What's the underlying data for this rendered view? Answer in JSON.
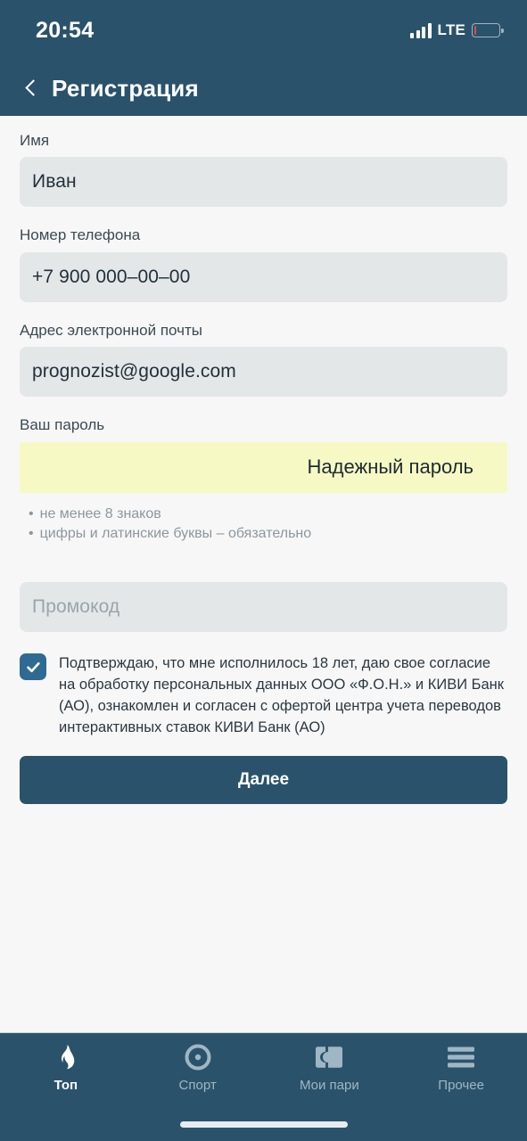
{
  "status_bar": {
    "time": "20:54",
    "network_label": "LTE",
    "signal_icon": "signal-bars-icon",
    "battery_icon": "battery-low-icon",
    "battery_level_percent": 10
  },
  "header": {
    "back_icon": "chevron-left-icon",
    "title": "Регистрация"
  },
  "form": {
    "fields": [
      {
        "label": "Имя",
        "value": "Иван",
        "placeholder": "",
        "name": "first-name"
      },
      {
        "label": "Номер телефона",
        "value": "+7 900 000–00–00",
        "placeholder": "",
        "name": "phone-number"
      },
      {
        "label": "Адрес электронной почты",
        "value": "prognozist@google.com",
        "placeholder": "",
        "name": "email"
      }
    ],
    "password": {
      "label": "Ваш пароль",
      "value": "",
      "strength_text": "Надежный пароль",
      "strength_bg_color": "#F7F9C4",
      "hints": [
        "не менее 8 знаков",
        "цифры и латинские буквы – обязательно"
      ]
    },
    "promo": {
      "label": "",
      "placeholder": "Промокод",
      "value": ""
    },
    "consent": {
      "checked": true,
      "checkbox_color": "#2E6A92",
      "check_icon": "checkmark-icon",
      "text": "Подтверждаю, что мне исполнилось 18 лет, даю свое согласие на обработку персональных данных ООО «Ф.О.Н.» и КИВИ Банк (АО), ознакомлен и согласен с офертой центра учета переводов интерактивных ставок КИВИ Банк (АО)"
    },
    "submit_label": "Далее"
  },
  "bottom_nav": {
    "items": [
      {
        "label": "Топ",
        "icon": "flame-icon",
        "active": true
      },
      {
        "label": "Спорт",
        "icon": "target-circle-icon",
        "active": false
      },
      {
        "label": "Мои пари",
        "icon": "ticket-icon",
        "active": false
      },
      {
        "label": "Прочее",
        "icon": "hamburger-menu-icon",
        "active": false
      }
    ]
  },
  "theme": {
    "primary": "#2A536B",
    "page_bg": "#F7F7F7",
    "input_bg": "#E3E7E8",
    "accent_yellow": "#F7F9C4"
  }
}
